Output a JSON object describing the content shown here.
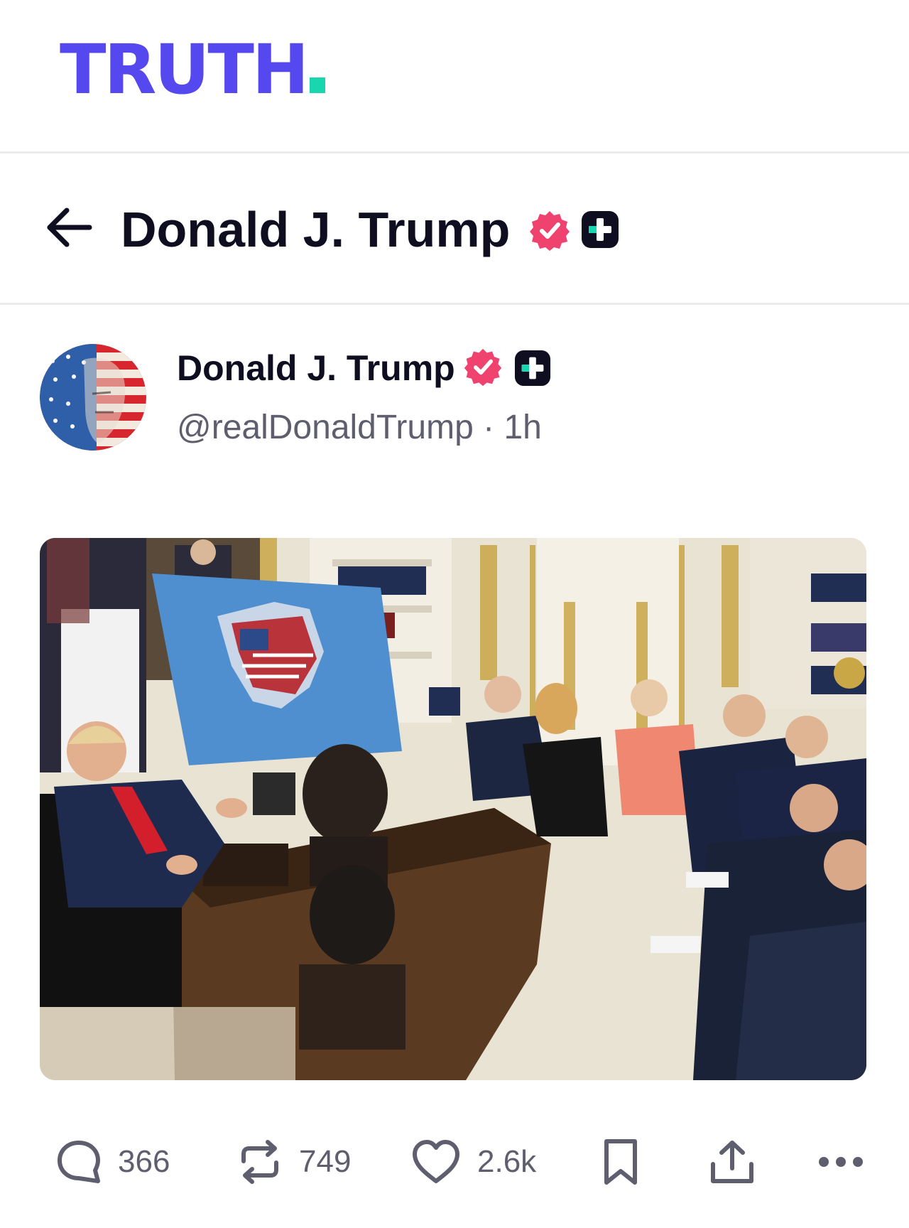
{
  "brand": {
    "logo_text": "TRUTH",
    "logo_color": "#5448ee",
    "logo_dot_color": "#17d6b0"
  },
  "header": {
    "back_icon": "arrow-left-icon",
    "title": "Donald J. Trump",
    "verified_icon": "verified-badge-icon",
    "plus_icon": "truth-plus-badge-icon"
  },
  "post": {
    "author": {
      "name": "Donald J. Trump",
      "handle": "@realDonaldTrump",
      "separator": "·",
      "time": "1h",
      "avatar_icon": "flag-portrait-avatar"
    },
    "image": {
      "kind": "photo"
    },
    "actions": {
      "reply": {
        "icon": "reply-bubble-icon",
        "count": "366"
      },
      "retruth": {
        "icon": "retruth-icon",
        "count": "749"
      },
      "like": {
        "icon": "heart-icon",
        "count": "2.6k"
      },
      "bookmark": {
        "icon": "bookmark-icon"
      },
      "share": {
        "icon": "share-icon"
      },
      "more": {
        "icon": "more-dots-icon"
      }
    }
  },
  "colors": {
    "verified": "#f0426e",
    "text_primary": "#0f0e21",
    "text_secondary": "#5f5e6e",
    "divider": "#ececec"
  }
}
